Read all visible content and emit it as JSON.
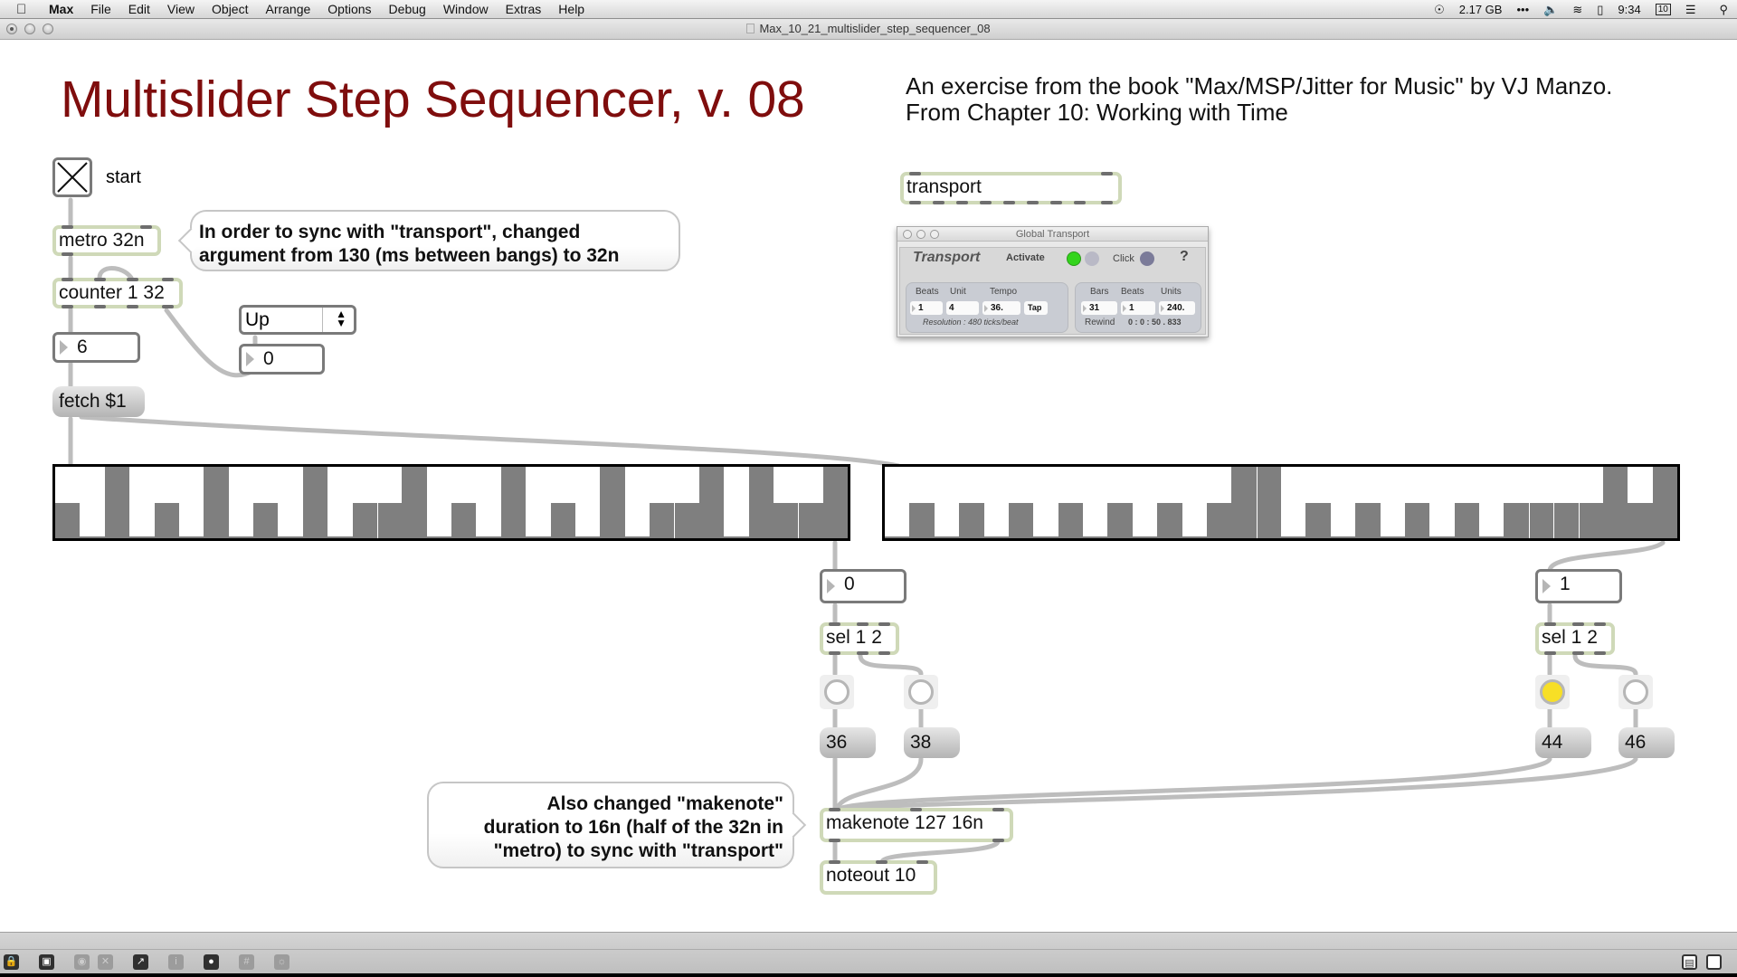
{
  "menubar": {
    "app": "Max",
    "items": [
      "File",
      "Edit",
      "View",
      "Object",
      "Arrange",
      "Options",
      "Debug",
      "Window",
      "Extras",
      "Help"
    ],
    "status": {
      "memory": "2.17 GB",
      "time": "9:34",
      "calendar_day": "10"
    }
  },
  "window": {
    "title": "Max_10_21_multislider_step_sequencer_08"
  },
  "patch": {
    "title": "Multislider Step Sequencer, v. 08",
    "book_line1": "An exercise from the book \"Max/MSP/Jitter for Music\" by VJ Manzo.",
    "book_line2": "From Chapter 10: Working with Time",
    "toggle_label": "start",
    "metro": "metro 32n",
    "counter": "counter 1 32",
    "counter_number": "6",
    "umenu_value": "Up",
    "direction_number": "0",
    "fetch": "fetch $1",
    "transport_object": "transport",
    "comment1_line1": "In order to sync with \"transport\", changed",
    "comment1_line2": "argument from 130 (ms between bangs) to 32n",
    "comment2_line1": "Also changed \"makenote\"",
    "comment2_line2": "duration to 16n (half of the 32n in",
    "comment2_line3": "\"metro) to sync with \"transport\"",
    "left": {
      "number": "0",
      "sel": "sel 1 2",
      "msg1": "36",
      "msg2": "38",
      "button1_on": false,
      "button2_on": false
    },
    "right": {
      "number": "1",
      "sel": "sel 1 2",
      "msg1": "44",
      "msg2": "46",
      "button1_on": true,
      "button2_on": false
    },
    "makenote": "makenote 127 16n",
    "noteout": "noteout 10",
    "multislider_range": [
      0,
      2
    ],
    "multislider_left": [
      1,
      0,
      2,
      0,
      1,
      0,
      2,
      0,
      1,
      0,
      2,
      0,
      1,
      1,
      2,
      0,
      1,
      0,
      2,
      0,
      1,
      0,
      2,
      0,
      1,
      1,
      2,
      0,
      2,
      1,
      1,
      2
    ],
    "multislider_right": [
      0,
      1,
      0,
      1,
      0,
      1,
      0,
      1,
      0,
      1,
      0,
      1,
      0,
      1,
      2,
      2,
      0,
      1,
      0,
      1,
      0,
      1,
      0,
      1,
      0,
      1,
      1,
      1,
      1,
      2,
      1,
      2
    ]
  },
  "global_transport": {
    "window_title": "Global Transport",
    "title": "Transport",
    "activate_label": "Activate",
    "activate_on": true,
    "click_label": "Click",
    "help": "?",
    "beats_label": "Beats",
    "unit_label": "Unit",
    "tempo_label": "Tempo",
    "beats": "1",
    "unit": "4",
    "tempo": "36.",
    "tap": "Tap",
    "resolution": "Resolution : 480 ticks/beat",
    "bars_label": "Bars",
    "beats2_label": "Beats",
    "units_label": "Units",
    "bars": "31",
    "beats2": "1",
    "units": "240.",
    "rewind": "Rewind",
    "time": "0 : 0 : 50 . 833",
    "colors": {
      "active": "#33d41c",
      "inactive": "#b9b9c6",
      "click": "#7b7b99"
    }
  },
  "colors": {
    "title": "#7f0d0d",
    "object_border": "#cfd9b8",
    "slider": "#7f7f7f",
    "button_on": "#f7df26"
  },
  "toolbar": {
    "left_icons": [
      "lock-icon",
      "presentation-icon",
      "binoculars-icon",
      "clear-icon",
      "inspector-chart-icon",
      "info-icon",
      "patch-cord-icon",
      "grid-icon",
      "debug-icon"
    ],
    "right_icons": [
      "split-horizontal-icon",
      "split-vertical-icon"
    ]
  }
}
